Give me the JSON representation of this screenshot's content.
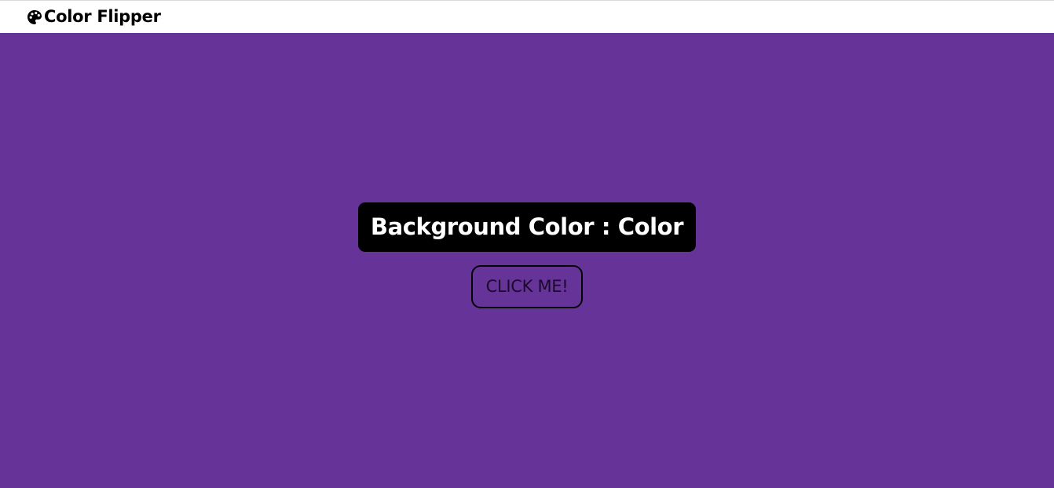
{
  "navbar": {
    "brand_icon": "palette-icon",
    "brand_text": "Color Flipper"
  },
  "main": {
    "label_prefix": "Background Color : ",
    "label_value": "Color",
    "button_label": "CLICK ME!"
  },
  "colors": {
    "background": "#663399",
    "navbar_background": "#ffffff",
    "label_background": "#000000",
    "label_text": "#ffffff"
  }
}
